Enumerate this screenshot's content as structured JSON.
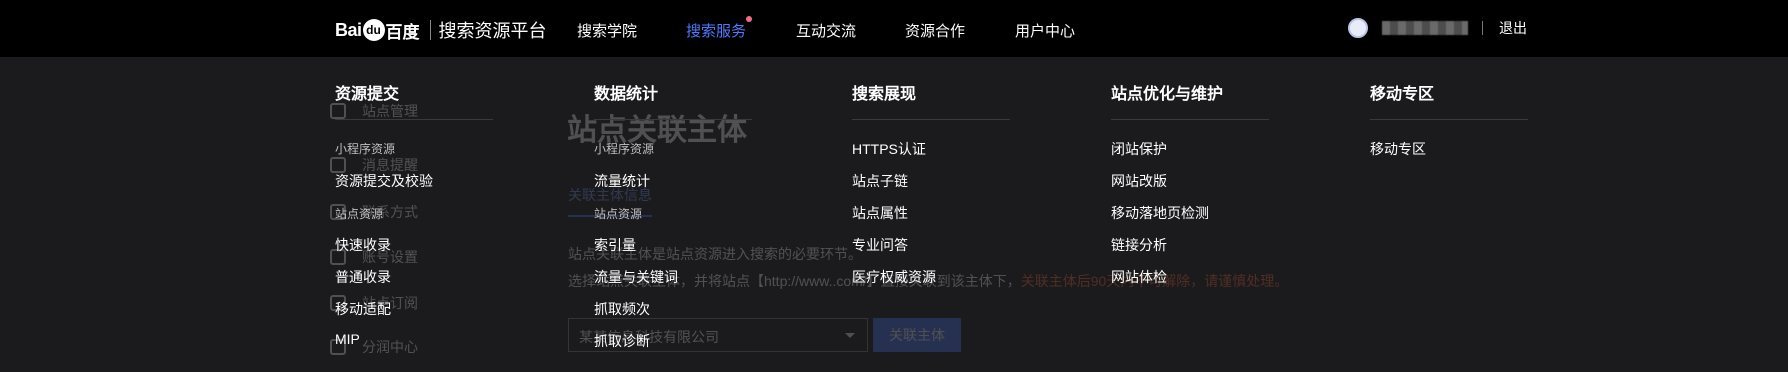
{
  "brand": {
    "logo_bai": "Bai",
    "logo_paw": "du",
    "logo_cn": "百度",
    "platform": "搜索资源平台"
  },
  "nav": {
    "items": [
      {
        "label": "搜索学院",
        "active": false
      },
      {
        "label": "搜索服务",
        "active": true,
        "has_dot": true
      },
      {
        "label": "互动交流",
        "active": false
      },
      {
        "label": "资源合作",
        "active": false
      },
      {
        "label": "用户中心",
        "active": false
      }
    ]
  },
  "user": {
    "avatar_icon": "avatar-icon",
    "logout": "退出"
  },
  "background_page": {
    "sidebar": [
      "站点管理",
      "消息提醒",
      "联系方式",
      "站点资源",
      "账号设置",
      "站点订阅",
      "分润中心"
    ],
    "title": "站点关联主体",
    "tab": "关联主体信息",
    "desc": "站点关联主体是站点资源进入搜索的必要环节。",
    "note_prefix": "选择站点关联主体，并将站点【http://www.",
    "note_mid": ".com/】直接关联到该主体下，",
    "note_warn": "关联主体后90天内不可解除，请谨慎处理。",
    "select_value": "某某信息科技有限公司",
    "button": "关联主体"
  },
  "menu": {
    "columns": [
      {
        "title": "资源提交",
        "entries": [
          {
            "type": "group",
            "text": "小程序资源"
          },
          {
            "type": "link",
            "text": "资源提交及校验"
          },
          {
            "type": "group",
            "text": "站点资源"
          },
          {
            "type": "link",
            "text": "快速收录"
          },
          {
            "type": "link",
            "text": "普通收录"
          },
          {
            "type": "link",
            "text": "移动适配"
          },
          {
            "type": "link",
            "text": "MIP"
          }
        ]
      },
      {
        "title": "数据统计",
        "entries": [
          {
            "type": "group",
            "text": "小程序资源"
          },
          {
            "type": "link",
            "text": "流量统计"
          },
          {
            "type": "group",
            "text": "站点资源"
          },
          {
            "type": "link",
            "text": "索引量"
          },
          {
            "type": "link",
            "text": "流量与关键词"
          },
          {
            "type": "link",
            "text": "抓取频次"
          },
          {
            "type": "link",
            "text": "抓取诊断"
          }
        ]
      },
      {
        "title": "搜索展现",
        "entries": [
          {
            "type": "link",
            "text": "HTTPS认证"
          },
          {
            "type": "link",
            "text": "站点子链"
          },
          {
            "type": "link",
            "text": "站点属性"
          },
          {
            "type": "link",
            "text": "专业问答"
          },
          {
            "type": "link",
            "text": "医疗权威资源"
          }
        ]
      },
      {
        "title": "站点优化与维护",
        "entries": [
          {
            "type": "link",
            "text": "闭站保护"
          },
          {
            "type": "link",
            "text": "网站改版"
          },
          {
            "type": "link",
            "text": "移动落地页检测"
          },
          {
            "type": "link",
            "text": "链接分析"
          },
          {
            "type": "link",
            "text": "网站体检"
          }
        ]
      },
      {
        "title": "移动专区",
        "entries": [
          {
            "type": "link",
            "text": "移动专区"
          }
        ]
      }
    ]
  },
  "colors": {
    "active_nav": "#4e7bff",
    "notify_dot": "#f06d8a",
    "warning_text": "#ff6b3d",
    "menu_bg": "#1b1b1d"
  }
}
